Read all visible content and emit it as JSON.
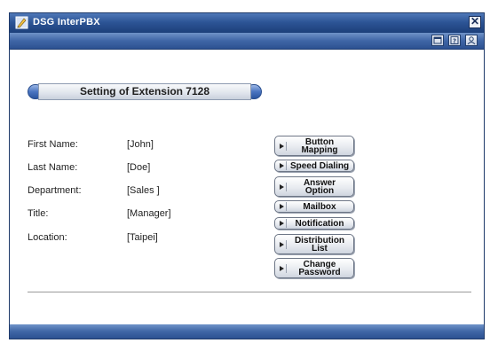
{
  "window": {
    "title": "DSG InterPBX",
    "close_glyph": "✕",
    "toolbar_icons": [
      "window-icon",
      "help-icon",
      "user-icon"
    ]
  },
  "panel": {
    "title": "Setting of Extension 7128"
  },
  "fields": [
    {
      "label": "First Name:",
      "value": "[John]"
    },
    {
      "label": "Last Name:",
      "value": "[Doe]"
    },
    {
      "label": "Department:",
      "value": "[Sales ]"
    },
    {
      "label": "Title:",
      "value": "[Manager]"
    },
    {
      "label": "Location:",
      "value": "[Taipei]"
    }
  ],
  "actions": [
    {
      "label": "Button\nMapping"
    },
    {
      "label": "Speed Dialing"
    },
    {
      "label": "Answer\nOption"
    },
    {
      "label": "Mailbox"
    },
    {
      "label": "Notification"
    },
    {
      "label": "Distribution\nList"
    },
    {
      "label": "Change\nPassword"
    }
  ],
  "colors": {
    "titlebar": "#2d5596",
    "accent": "#4a74c0"
  }
}
